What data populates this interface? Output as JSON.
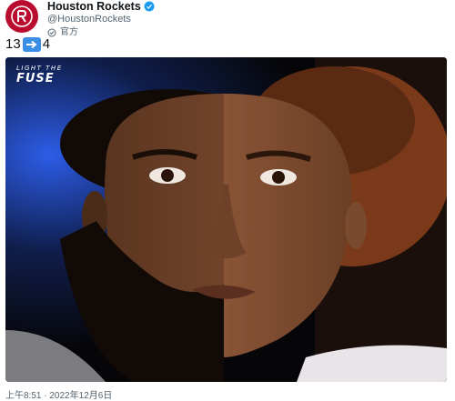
{
  "account": {
    "display_name": "Houston Rockets",
    "handle": "@HoustonRockets",
    "affiliation_label": "官方"
  },
  "tweet": {
    "text_before": "13",
    "text_after": "4",
    "emoji": "right-arrow-emoji"
  },
  "media": {
    "overlay_line1": "LIGHT THE",
    "overlay_line2": "FUSE"
  },
  "meta": {
    "timestamp": "上午8:51 · 2022年12月6日"
  },
  "colors": {
    "brand": "#ba0c2f",
    "verified": "#1d9bf0",
    "muted_text": "#536471"
  }
}
